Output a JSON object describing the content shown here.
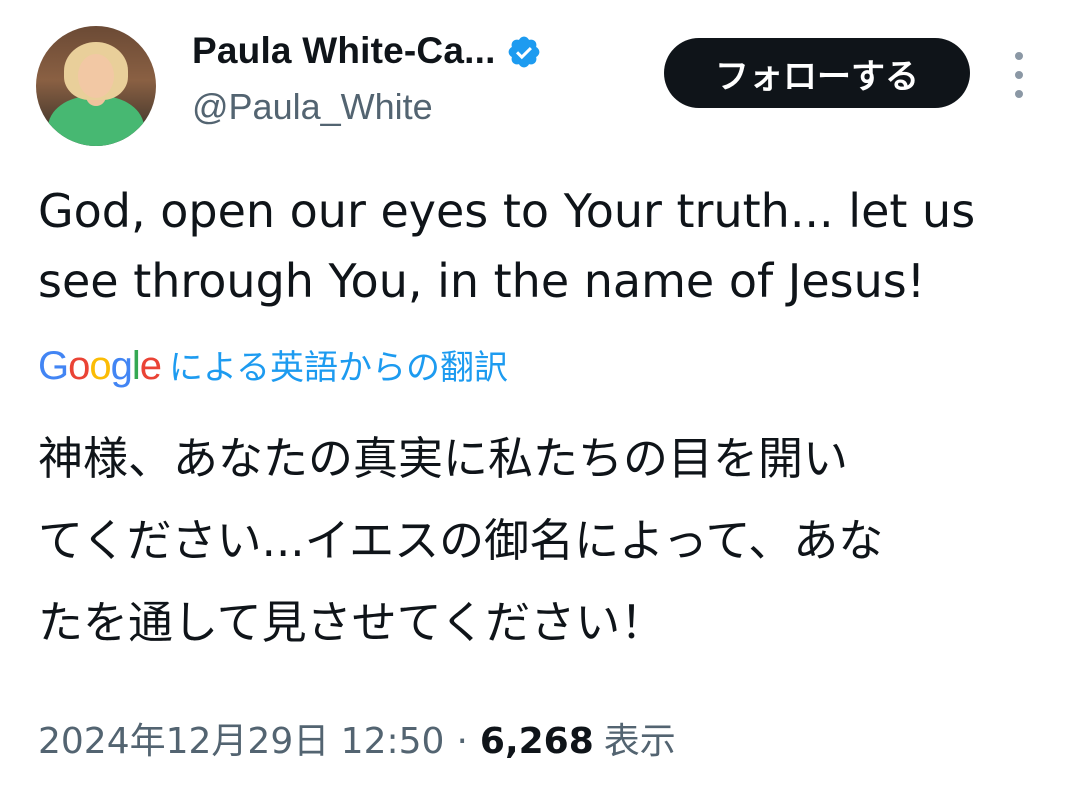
{
  "author": {
    "display_name": "Paula White-Ca...",
    "handle": "@Paula_White",
    "verified": true
  },
  "follow_label": "フォローする",
  "tweet": {
    "text": "God, open our eyes to Your truth... let us\nsee through You, in the name of Jesus!",
    "translation_source": {
      "google_letters": [
        "G",
        "o",
        "o",
        "g",
        "l",
        "e"
      ],
      "google_colors": [
        "#4285F4",
        "#EA4335",
        "#FBBC05",
        "#4285F4",
        "#34A853",
        "#EA4335"
      ],
      "label": "による英語からの翻訳"
    },
    "translated_text": "神様、あなたの真実に私たちの目を開い\nてください...イエスの御名によって、あな\nたを通して見させてください！"
  },
  "meta": {
    "timestamp": "2024年12月29日 12:50",
    "separator": "·",
    "views_count": "6,268",
    "views_label": "表示"
  },
  "colors": {
    "accent": "#1d9bf0",
    "text": "#0f1419",
    "muted": "#536471",
    "button_bg": "#0f1419"
  },
  "icons": [
    "verified-badge-icon",
    "more-options-icon"
  ]
}
